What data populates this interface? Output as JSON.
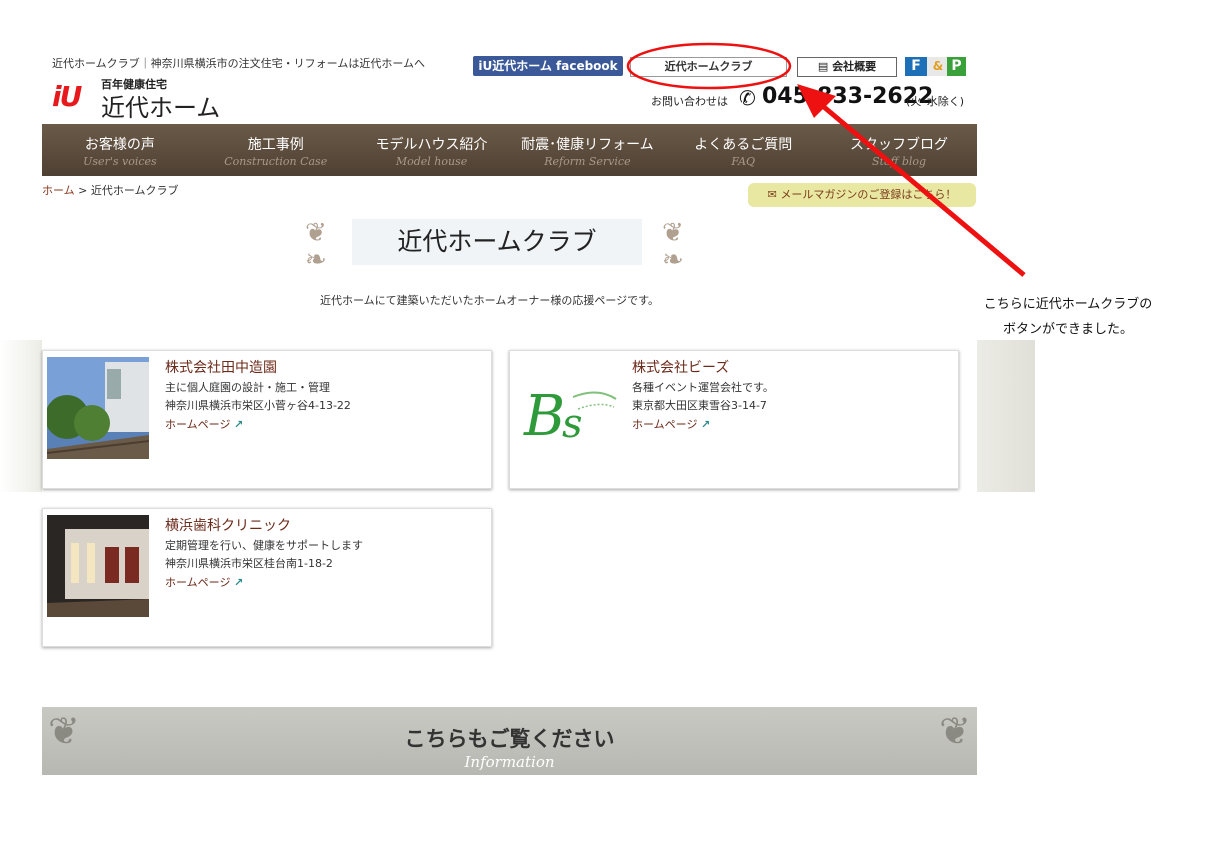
{
  "header": {
    "topline": "近代ホームクラブ｜神奈川県横浜市の注文住宅・リフォームは近代ホームへ",
    "facebook_label": "iU近代ホーム facebook",
    "club_label": "近代ホームクラブ",
    "company_label": "会社概要",
    "badge_f": "F",
    "badge_p": "P",
    "logo_mark": "iU",
    "logo_sub": "百年健康住宅",
    "logo_name": "近代ホーム",
    "contact_label": "お問い合わせは",
    "phone": "045-833-2622",
    "phone_note": "(火･水除く)"
  },
  "nav": [
    {
      "jp": "お客様の声",
      "en": "User's voices"
    },
    {
      "jp": "施工事例",
      "en": "Construction Case"
    },
    {
      "jp": "モデルハウス紹介",
      "en": "Model house"
    },
    {
      "jp": "耐震･健康リフォーム",
      "en": "Reform Service"
    },
    {
      "jp": "よくあるご質問",
      "en": "FAQ"
    },
    {
      "jp": "スタッフブログ",
      "en": "Staff blog"
    }
  ],
  "breadcrumb": {
    "home": "ホーム",
    "sep": " > ",
    "current": "近代ホームクラブ"
  },
  "mail_banner": "メールマガジンのご登録はこちら！",
  "page_title": "近代ホームクラブ",
  "intro": "近代ホームにて建築いただいたホームオーナー様の応援ページです。",
  "cards": [
    {
      "title": "株式会社田中造園",
      "desc": "主に個人庭園の設計・施工・管理",
      "address": "神奈川県横浜市栄区小菅ヶ谷4-13-22",
      "link": "ホームページ"
    },
    {
      "title": "株式会社ビーズ",
      "desc": "各種イベント運営会社です。",
      "address": "東京都大田区東雪谷3-14-7",
      "link": "ホームページ"
    },
    {
      "title": "横浜歯科クリニック",
      "desc": "定期管理を行い、健康をサポートします",
      "address": "神奈川県横浜市栄区桂台南1-18-2",
      "link": "ホームページ"
    }
  ],
  "info_banner": {
    "title": "こちらもご覧ください",
    "subtitle": "Information"
  },
  "annotation": {
    "line1": "こちらに近代ホームクラブの",
    "line2": "ボタンができました。"
  },
  "colors": {
    "nav_bg": "#5a4a3b",
    "accent_red": "#e8191d",
    "link": "#6b2a1a",
    "facebook": "#3b5998"
  }
}
